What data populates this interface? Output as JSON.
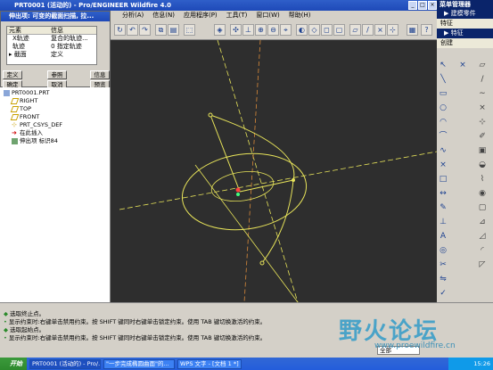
{
  "window": {
    "title": "PRT0001 (活动的) - Pro/ENGINEER Wildfire 4.0"
  },
  "menu": [
    "分析(A)",
    "信息(N)",
    "应用程序(P)",
    "工具(T)",
    "窗口(W)",
    "帮助(H)"
  ],
  "right_panel": {
    "title": "菜单管理器",
    "items": [
      "▶ 建模零件",
      "特征",
      "▶ 特征",
      "创建"
    ]
  },
  "dialog": {
    "title": "伸出项: 可变的截面扫描, 拉...",
    "col_element": "元素",
    "col_info": "信息",
    "rows": [
      {
        "element": "X轨迹",
        "info": "复合的轨迹..."
      },
      {
        "element": "轨迹",
        "info": "0 指定轨迹"
      },
      {
        "element": "截面",
        "info": "定义"
      }
    ],
    "btn_define": "定义",
    "btn_refs": "参照",
    "btn_info": "信息",
    "btn_ok": "确定",
    "btn_cancel": "取消",
    "btn_preview": "预览"
  },
  "tree": {
    "root": "PRT0001.PRT",
    "items": [
      "RIGHT",
      "TOP",
      "FRONT",
      "PRT_CSYS_DEF",
      "在此插入",
      "伸出项 标识84"
    ]
  },
  "messages": [
    "选取终止点。",
    "显示约束时:右键单击禁用约束。按 SHIFT 键同时右键单击锁定约束。使用 TAB 键切换激活的约束。",
    "选取起始点。",
    "显示约束时:右键单击禁用约束。按 SHIFT 键同时右键单击锁定约束。使用 TAB 键切换激活的约束。"
  ],
  "filter": "全部",
  "taskbar": {
    "start": "开始",
    "tasks": [
      "PRT0001 (活动的) - Pro/...",
      "\"一步完成椭圆曲面\"的...",
      "WPS 文字 - [文档 1 *]"
    ],
    "clock": "15:26"
  },
  "watermark": {
    "text": "野火论坛",
    "url": "www.proewildfire.cn"
  },
  "colors": {
    "canvas": "#2e2e2e",
    "sketch": "#e8e45a",
    "dim": "#d98a3a",
    "titlebar": "#1e49b8"
  }
}
